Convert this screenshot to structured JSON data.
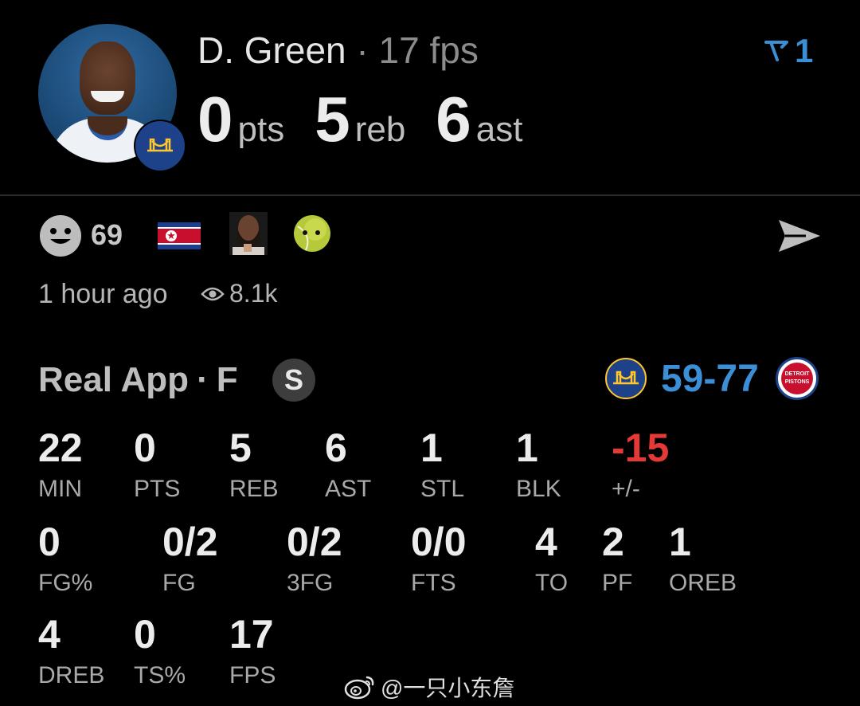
{
  "player": {
    "name": "D. Green",
    "separator": "·",
    "fps_label": "17 fps",
    "avatar_icon": "player-photo",
    "team_badge_icon": "warriors-logo",
    "statline": [
      {
        "value": "0",
        "unit": "pts"
      },
      {
        "value": "5",
        "unit": "reb"
      },
      {
        "value": "6",
        "unit": "ast"
      }
    ],
    "rank_value": "1",
    "rank_icon": "vote-arrow-icon",
    "accent_color": "#3a8fd6"
  },
  "reactions": {
    "smile_count": "69",
    "items": [
      "smile-emoji",
      "north-korea-flag-emoji",
      "harden-emoji",
      "tennis-ball-emoji"
    ],
    "send_icon": "send-icon"
  },
  "meta": {
    "time_ago": "1 hour ago",
    "views": "8.1k"
  },
  "game": {
    "source": "Real App",
    "separator": "·",
    "status": "F",
    "badge": "S",
    "score": "59-77",
    "home_logo": "warriors-logo",
    "away_logo": "pistons-logo",
    "away_logo_text": "DETROIT PISTONS"
  },
  "box_score": {
    "row1": [
      {
        "value": "22",
        "label": "MIN"
      },
      {
        "value": "0",
        "label": "PTS"
      },
      {
        "value": "5",
        "label": "REB"
      },
      {
        "value": "6",
        "label": "AST"
      },
      {
        "value": "1",
        "label": "STL"
      },
      {
        "value": "1",
        "label": "BLK"
      },
      {
        "value": "-15",
        "label": "+/-"
      }
    ],
    "row2": [
      {
        "value": "0",
        "label": "FG%"
      },
      {
        "value": "0/2",
        "label": "FG"
      },
      {
        "value": "0/2",
        "label": "3FG"
      },
      {
        "value": "0/0",
        "label": "FTS"
      },
      {
        "value": "4",
        "label": "TO"
      },
      {
        "value": "2",
        "label": "PF"
      },
      {
        "value": "1",
        "label": "OREB"
      }
    ],
    "row3": [
      {
        "value": "4",
        "label": "DREB"
      },
      {
        "value": "0",
        "label": "TS%"
      },
      {
        "value": "17",
        "label": "FPS"
      }
    ],
    "negative_color": "#e53935"
  },
  "watermark": {
    "text": "@一只小东詹",
    "icon": "weibo-icon"
  }
}
